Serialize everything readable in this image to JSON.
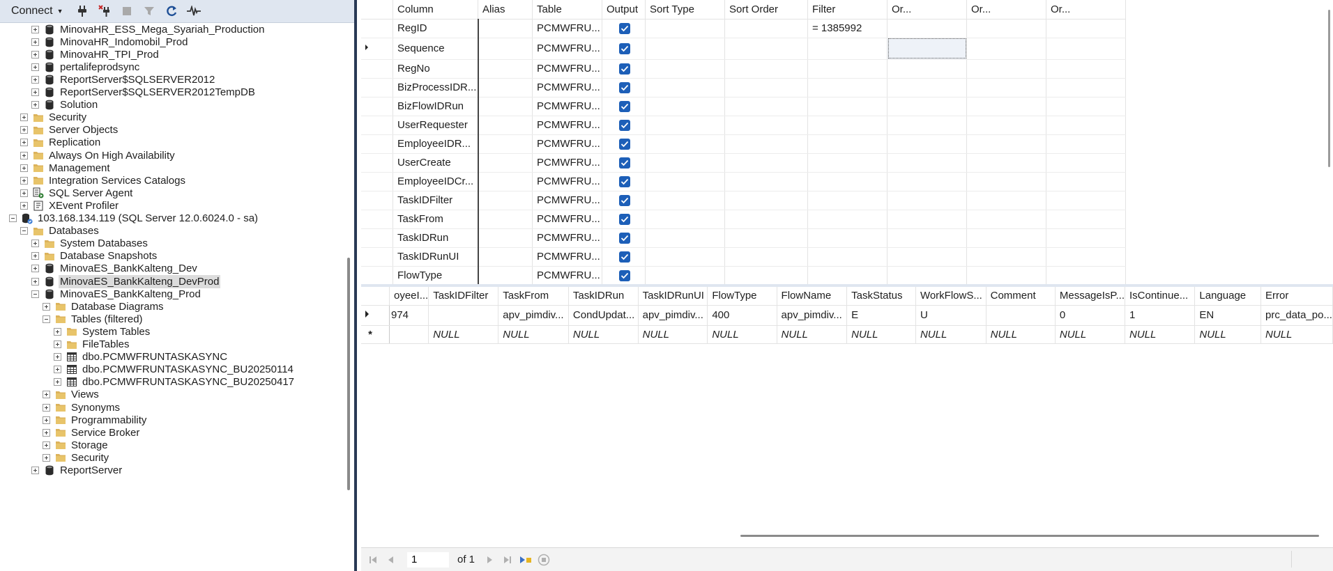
{
  "toolbar": {
    "connect_label": "Connect",
    "icons": [
      "connect-plug-icon",
      "disconnect-icon",
      "stop-icon",
      "filter-icon",
      "refresh-icon",
      "activity-monitor-icon"
    ]
  },
  "tree": [
    {
      "label": "MinovaHR_ESS_Mega_Syariah_Production",
      "icon": "database-icon",
      "level": 2,
      "expander": "plus"
    },
    {
      "label": "MinovaHR_Indomobil_Prod",
      "icon": "database-icon",
      "level": 2,
      "expander": "plus"
    },
    {
      "label": "MinovaHR_TPI_Prod",
      "icon": "database-icon",
      "level": 2,
      "expander": "plus"
    },
    {
      "label": "pertalifeprodsync",
      "icon": "database-icon",
      "level": 2,
      "expander": "plus"
    },
    {
      "label": "ReportServer$SQLSERVER2012",
      "icon": "database-icon",
      "level": 2,
      "expander": "plus"
    },
    {
      "label": "ReportServer$SQLSERVER2012TempDB",
      "icon": "database-icon",
      "level": 2,
      "expander": "plus"
    },
    {
      "label": "Solution",
      "icon": "database-icon",
      "level": 2,
      "expander": "plus"
    },
    {
      "label": "Security",
      "icon": "folder-icon",
      "level": 1,
      "expander": "plus"
    },
    {
      "label": "Server Objects",
      "icon": "folder-icon",
      "level": 1,
      "expander": "plus"
    },
    {
      "label": "Replication",
      "icon": "folder-icon",
      "level": 1,
      "expander": "plus"
    },
    {
      "label": "Always On High Availability",
      "icon": "folder-icon",
      "level": 1,
      "expander": "plus"
    },
    {
      "label": "Management",
      "icon": "folder-icon",
      "level": 1,
      "expander": "plus"
    },
    {
      "label": "Integration Services Catalogs",
      "icon": "folder-icon",
      "level": 1,
      "expander": "plus"
    },
    {
      "label": "SQL Server Agent",
      "icon": "agent-icon",
      "level": 1,
      "expander": "plus"
    },
    {
      "label": "XEvent Profiler",
      "icon": "profiler-icon",
      "level": 1,
      "expander": "plus"
    },
    {
      "label": "103.168.134.119 (SQL Server 12.0.6024.0 - sa)",
      "icon": "server-icon",
      "level": 0,
      "expander": "minus"
    },
    {
      "label": "Databases",
      "icon": "folder-icon",
      "level": 1,
      "expander": "minus"
    },
    {
      "label": "System Databases",
      "icon": "folder-icon",
      "level": 2,
      "expander": "plus"
    },
    {
      "label": "Database Snapshots",
      "icon": "folder-icon",
      "level": 2,
      "expander": "plus"
    },
    {
      "label": "MinovaES_BankKalteng_Dev",
      "icon": "database-icon",
      "level": 2,
      "expander": "plus"
    },
    {
      "label": "MinovaES_BankKalteng_DevProd",
      "icon": "database-icon",
      "level": 2,
      "expander": "plus",
      "selected": true
    },
    {
      "label": "MinovaES_BankKalteng_Prod",
      "icon": "database-icon",
      "level": 2,
      "expander": "minus"
    },
    {
      "label": "Database Diagrams",
      "icon": "folder-icon",
      "level": 3,
      "expander": "plus"
    },
    {
      "label": "Tables (filtered)",
      "icon": "folder-icon",
      "level": 3,
      "expander": "minus"
    },
    {
      "label": "System Tables",
      "icon": "folder-icon",
      "level": 4,
      "expander": "plus"
    },
    {
      "label": "FileTables",
      "icon": "folder-icon",
      "level": 4,
      "expander": "plus"
    },
    {
      "label": "dbo.PCMWFRUNTASKASYNC",
      "icon": "table-icon",
      "level": 4,
      "expander": "plus"
    },
    {
      "label": "dbo.PCMWFRUNTASKASYNC_BU20250114",
      "icon": "table-icon",
      "level": 4,
      "expander": "plus"
    },
    {
      "label": "dbo.PCMWFRUNTASKASYNC_BU20250417",
      "icon": "table-icon",
      "level": 4,
      "expander": "plus"
    },
    {
      "label": "Views",
      "icon": "folder-icon",
      "level": 3,
      "expander": "plus"
    },
    {
      "label": "Synonyms",
      "icon": "folder-icon",
      "level": 3,
      "expander": "plus"
    },
    {
      "label": "Programmability",
      "icon": "folder-icon",
      "level": 3,
      "expander": "plus"
    },
    {
      "label": "Service Broker",
      "icon": "folder-icon",
      "level": 3,
      "expander": "plus"
    },
    {
      "label": "Storage",
      "icon": "folder-icon",
      "level": 3,
      "expander": "plus"
    },
    {
      "label": "Security",
      "icon": "folder-icon",
      "level": 3,
      "expander": "plus"
    },
    {
      "label": "ReportServer",
      "icon": "database-icon",
      "level": 2,
      "expander": "plus"
    }
  ],
  "criteria": {
    "headers": [
      "Column",
      "Alias",
      "Table",
      "Output",
      "Sort Type",
      "Sort Order",
      "Filter",
      "Or...",
      "Or...",
      "Or..."
    ],
    "rows": [
      {
        "column": "RegID",
        "table": "PCMWFRU...",
        "output": true,
        "filter": "= 1385992"
      },
      {
        "column": "Sequence",
        "table": "PCMWFRU...",
        "output": true,
        "filter": "",
        "current": true
      },
      {
        "column": "RegNo",
        "table": "PCMWFRU...",
        "output": true,
        "filter": ""
      },
      {
        "column": "BizProcessIDR...",
        "table": "PCMWFRU...",
        "output": true,
        "filter": ""
      },
      {
        "column": "BizFlowIDRun",
        "table": "PCMWFRU...",
        "output": true,
        "filter": ""
      },
      {
        "column": "UserRequester",
        "table": "PCMWFRU...",
        "output": true,
        "filter": ""
      },
      {
        "column": "EmployeeIDR...",
        "table": "PCMWFRU...",
        "output": true,
        "filter": ""
      },
      {
        "column": "UserCreate",
        "table": "PCMWFRU...",
        "output": true,
        "filter": ""
      },
      {
        "column": "EmployeeIDCr...",
        "table": "PCMWFRU...",
        "output": true,
        "filter": ""
      },
      {
        "column": "TaskIDFilter",
        "table": "PCMWFRU...",
        "output": true,
        "filter": ""
      },
      {
        "column": "TaskFrom",
        "table": "PCMWFRU...",
        "output": true,
        "filter": ""
      },
      {
        "column": "TaskIDRun",
        "table": "PCMWFRU...",
        "output": true,
        "filter": ""
      },
      {
        "column": "TaskIDRunUI",
        "table": "PCMWFRU...",
        "output": true,
        "filter": ""
      },
      {
        "column": "FlowType",
        "table": "PCMWFRU...",
        "output": true,
        "filter": ""
      }
    ]
  },
  "results": {
    "headers": [
      "oyeeI...",
      "TaskIDFilter",
      "TaskFrom",
      "TaskIDRun",
      "TaskIDRunUI",
      "FlowType",
      "FlowName",
      "TaskStatus",
      "WorkFlowS...",
      "Comment",
      "MessageIsP...",
      "IsContinue...",
      "Language",
      "Error"
    ],
    "rows": [
      {
        "marker": "current",
        "cells": [
          "974",
          "",
          "apv_pimdiv...",
          "CondUpdat...",
          "apv_pimdiv...",
          "400",
          "apv_pimdiv...",
          "E",
          "U",
          "",
          "0",
          "1",
          "EN",
          "prc_data_po..."
        ]
      },
      {
        "marker": "new",
        "cells": [
          "",
          "NULL",
          "NULL",
          "NULL",
          "NULL",
          "NULL",
          "NULL",
          "NULL",
          "NULL",
          "NULL",
          "NULL",
          "NULL",
          "NULL",
          "NULL"
        ]
      }
    ],
    "null_text": "NULL",
    "new_row_marker": "*"
  },
  "navigator": {
    "page_value": "1",
    "page_of": "of 1"
  }
}
